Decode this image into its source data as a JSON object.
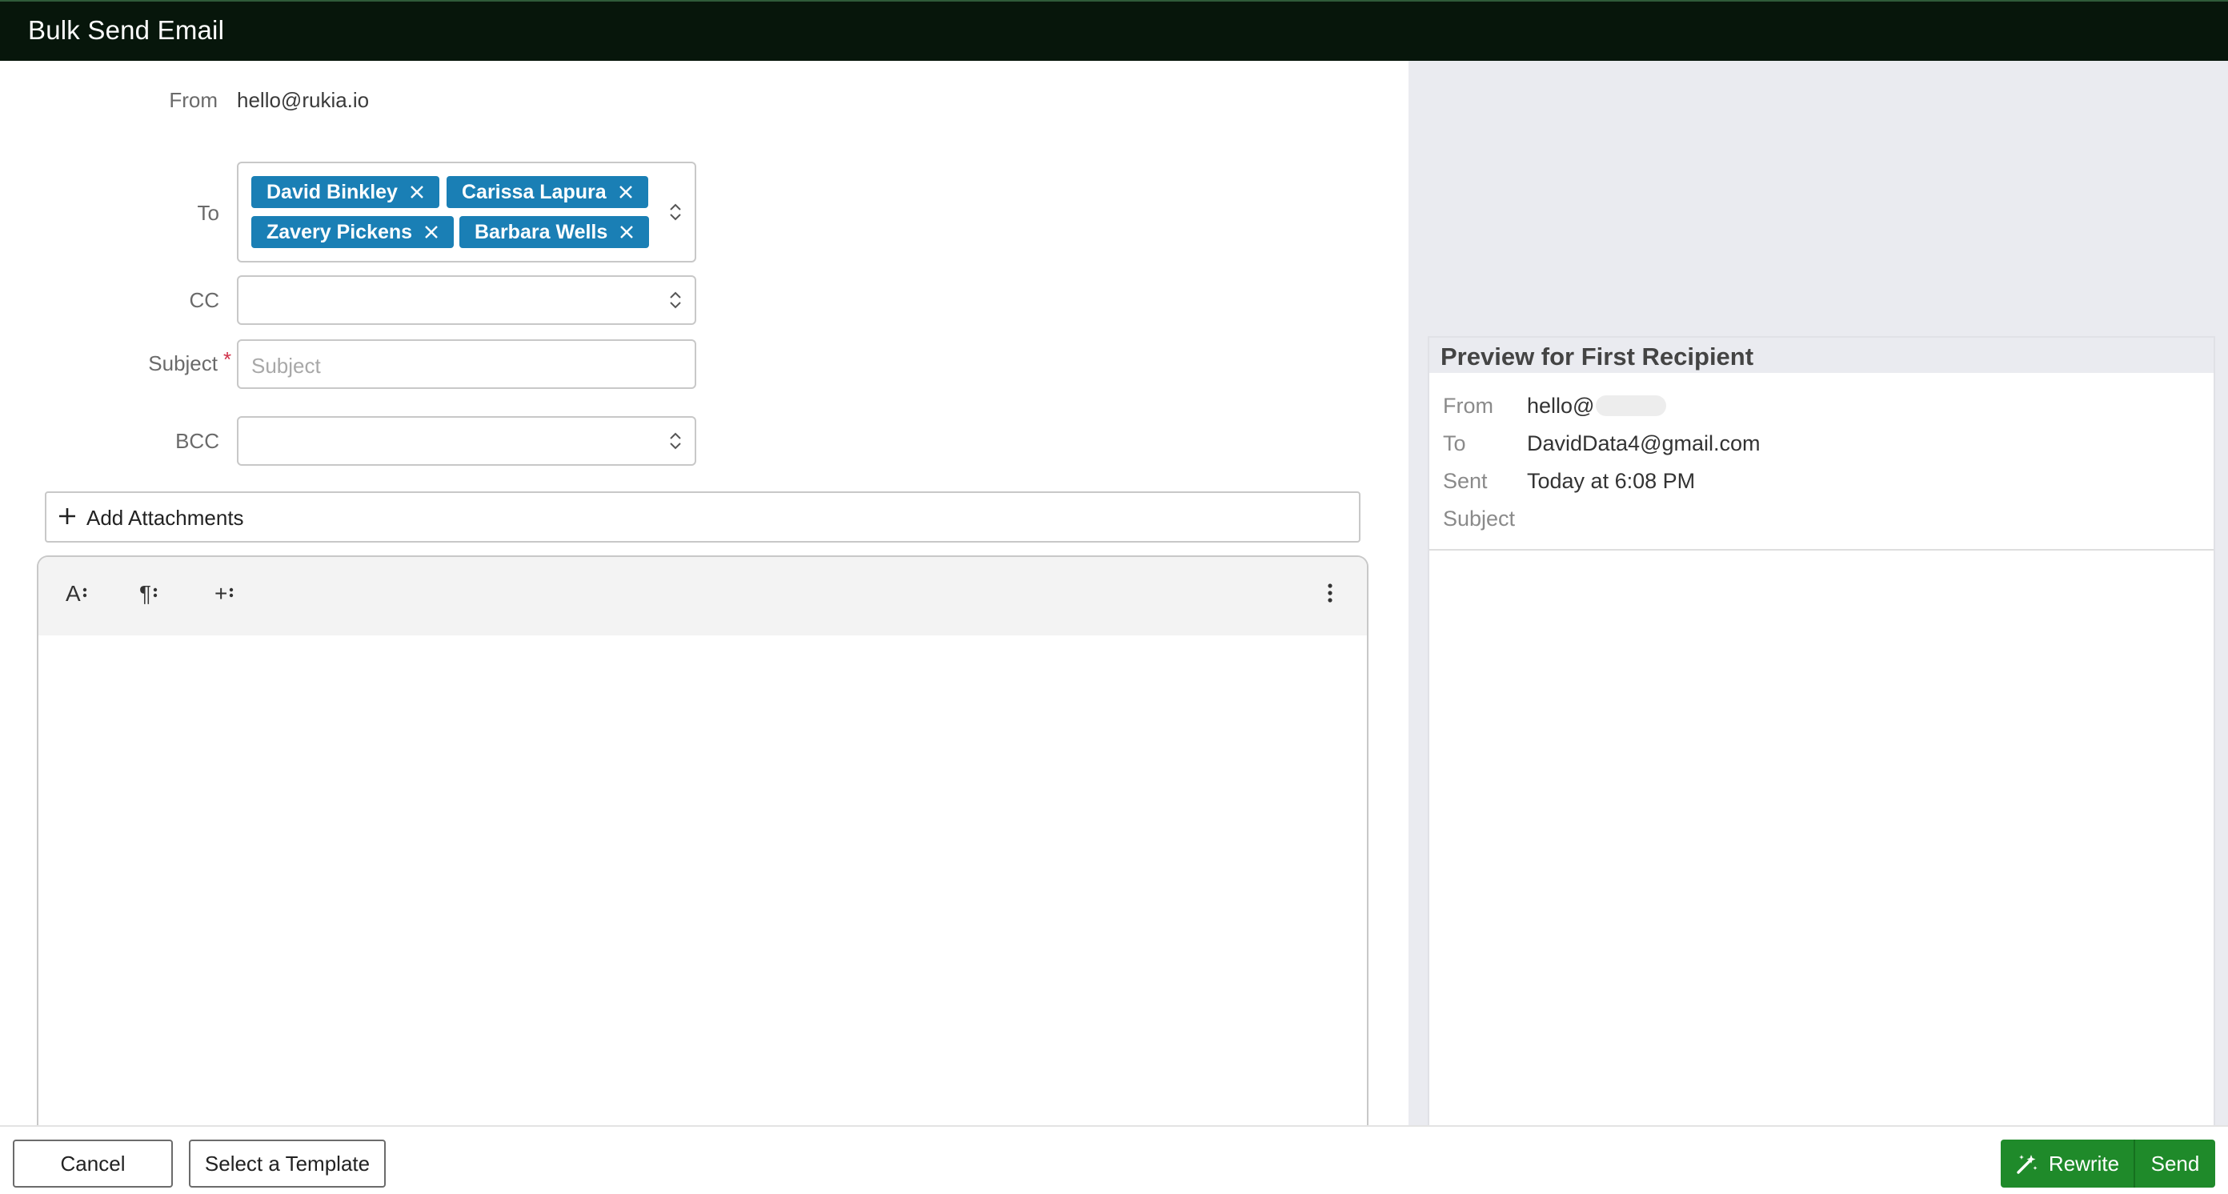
{
  "window": {
    "title": "Bulk Send Email"
  },
  "form": {
    "from_label": "From",
    "from_value": "hello@rukia.io",
    "to_label": "To",
    "recipients": [
      {
        "name": "David Binkley"
      },
      {
        "name": "Carissa Lapura"
      },
      {
        "name": "Zavery Pickens"
      },
      {
        "name": "Barbara Wells"
      }
    ],
    "cc_label": "CC",
    "cc_value": "",
    "subject_label": "Subject",
    "subject_required_mark": "*",
    "subject_placeholder": "Subject",
    "bcc_label": "BCC",
    "bcc_value": ""
  },
  "attachments": {
    "label": "Add Attachments"
  },
  "editor": {
    "toolbar": [
      {
        "icon": "text-style-icon",
        "glyph": "A"
      },
      {
        "icon": "paragraph-icon",
        "glyph": "¶"
      },
      {
        "icon": "insert-icon",
        "glyph": "+"
      }
    ],
    "more_icon": "more-vertical-icon",
    "body": ""
  },
  "preview": {
    "title": "Preview for First Recipient",
    "from_label": "From",
    "from_value": "hello@",
    "to_label": "To",
    "to_value": "DavidData4@gmail.com",
    "sent_label": "Sent",
    "sent_value": "Today at 6:08 PM",
    "subject_label": "Subject",
    "subject_value": ""
  },
  "footer": {
    "cancel_label": "Cancel",
    "template_label": "Select a Template",
    "rewrite_label": "Rewrite",
    "send_label": "Send"
  },
  "colors": {
    "titlebar": "#07160b",
    "chip": "#1a7fb5",
    "primary_button": "#1f8a2a",
    "required": "#d0324a",
    "right_panel_bg": "#eaebf0"
  }
}
